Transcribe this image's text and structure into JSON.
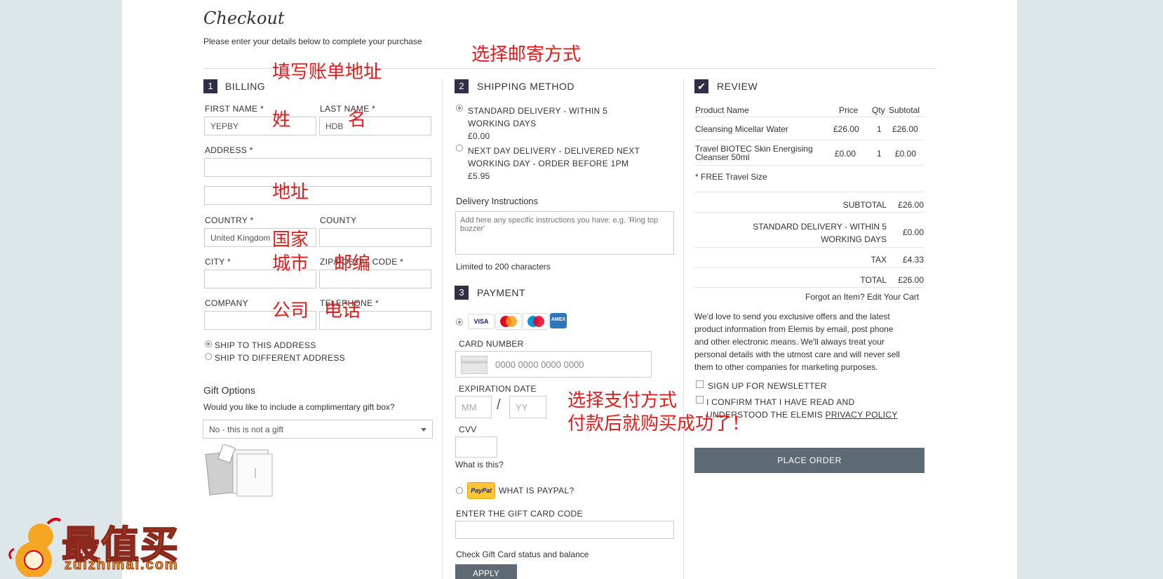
{
  "header": {
    "title": "Checkout",
    "subtitle": "Please enter your details below to complete your purchase"
  },
  "billing": {
    "step": "1",
    "heading": "BILLING",
    "first_name_label": "FIRST NAME *",
    "first_name_value": "YEPBY",
    "last_name_label": "LAST NAME *",
    "last_name_value": "HDB",
    "address_label": "ADDRESS *",
    "country_label": "COUNTRY *",
    "country_value": "United Kingdom",
    "county_label": "COUNTY",
    "city_label": "CITY *",
    "zip_label": "ZIP/POSTAL CODE *",
    "company_label": "COMPANY",
    "telephone_label": "TELEPHONE *",
    "ship_same": "SHIP TO THIS ADDRESS",
    "ship_different": "SHIP TO DIFFERENT ADDRESS",
    "gift_heading": "Gift Options",
    "gift_question": "Would you like to include a complimentary gift box?",
    "gift_select": "No - this is not a gift"
  },
  "shipping": {
    "step": "2",
    "heading": "SHIPPING METHOD",
    "option1_line1": "STANDARD DELIVERY - WITHIN 5",
    "option1_line2": "WORKING DAYS",
    "option1_price": "£0.00",
    "option2_line1": "NEXT DAY DELIVERY - DELIVERED NEXT",
    "option2_line2": "WORKING DAY - ORDER BEFORE 1PM",
    "option2_price": "£5.95",
    "instructions_label": "Delivery Instructions",
    "instructions_placeholder": "Add here any specific instructions you have: e.g. 'Ring top buzzer'",
    "limit_note": "Limited to 200 characters"
  },
  "payment": {
    "step": "3",
    "heading": "PAYMENT",
    "cards": [
      "VISA",
      "mastercard",
      "Maestro",
      "AMEX"
    ],
    "card_number_label": "CARD NUMBER",
    "card_number_placeholder": "0000 0000 0000 0000",
    "expiry_label": "EXPIRATION DATE",
    "mm_placeholder": "MM",
    "slash": "/",
    "yy_placeholder": "YY",
    "cvv_label": "CVV",
    "what_is_this": "What is this?",
    "paypal_logo": "PayPal",
    "paypal_label": "WHAT IS PAYPAL?",
    "giftcard_label": "ENTER THE GIFT CARD CODE",
    "giftcard_status": "Check Gift Card status and balance",
    "apply": "APPLY"
  },
  "review": {
    "heading": "REVIEW",
    "columns": {
      "name": "Product Name",
      "price": "Price",
      "qty": "Qty",
      "subtotal": "Subtotal"
    },
    "items": [
      {
        "name": "Cleansing Micellar Water",
        "name2": "",
        "price": "£26.00",
        "qty": "1",
        "subtotal": "£26.00"
      },
      {
        "name": "Travel BIOTEC Skin Energising",
        "name2": "Cleanser 50ml",
        "price": "£0.00",
        "qty": "1",
        "subtotal": "£0.00"
      }
    ],
    "free_note": "* FREE Travel Size",
    "subtotal_label": "SUBTOTAL",
    "subtotal_value": "£26.00",
    "delivery_label1": "STANDARD DELIVERY - WITHIN 5",
    "delivery_label2": "WORKING DAYS",
    "delivery_value": "£0.00",
    "tax_label": "TAX",
    "tax_value": "£4.33",
    "total_label": "TOTAL",
    "total_value": "£26.00",
    "forgot_text": "Forgot an Item? ",
    "edit_cart": "Edit Your Cart",
    "marketing": [
      "We'd love to send you exclusive offers and the latest",
      "product information from Elemis by email, post phone",
      "and other electronic means. We'll always treat your",
      "personal details with the utmost care and will never sell",
      "them to other companies for marketing purposes."
    ],
    "newsletter": "SIGN UP FOR NEWSLETTER",
    "confirm_line1": "I CONFIRM THAT I HAVE READ AND",
    "confirm_line2": "UNDERSTOOD THE ELEMIS ",
    "privacy_link": "PRIVACY POLICY",
    "place_order": "PLACE ORDER"
  },
  "annotations": {
    "fill_billing": "填写账单地址",
    "choose_shipping": "选择邮寄方式",
    "surname": "姓",
    "given_name": "名",
    "address": "地址",
    "country": "国家",
    "city": "城市",
    "postcode": "邮编",
    "company": "公司",
    "phone": "电话",
    "choose_payment": "选择支付方式",
    "done": "付款后就购买成功了！"
  },
  "watermark": {
    "brand": "最值买",
    "url": "zuizhimai.com"
  },
  "colors": {
    "page_bg": "#dde6e8",
    "step_badge": "#2f2f45",
    "order_button": "#5d6a73",
    "annotation": "#e21b1b"
  }
}
